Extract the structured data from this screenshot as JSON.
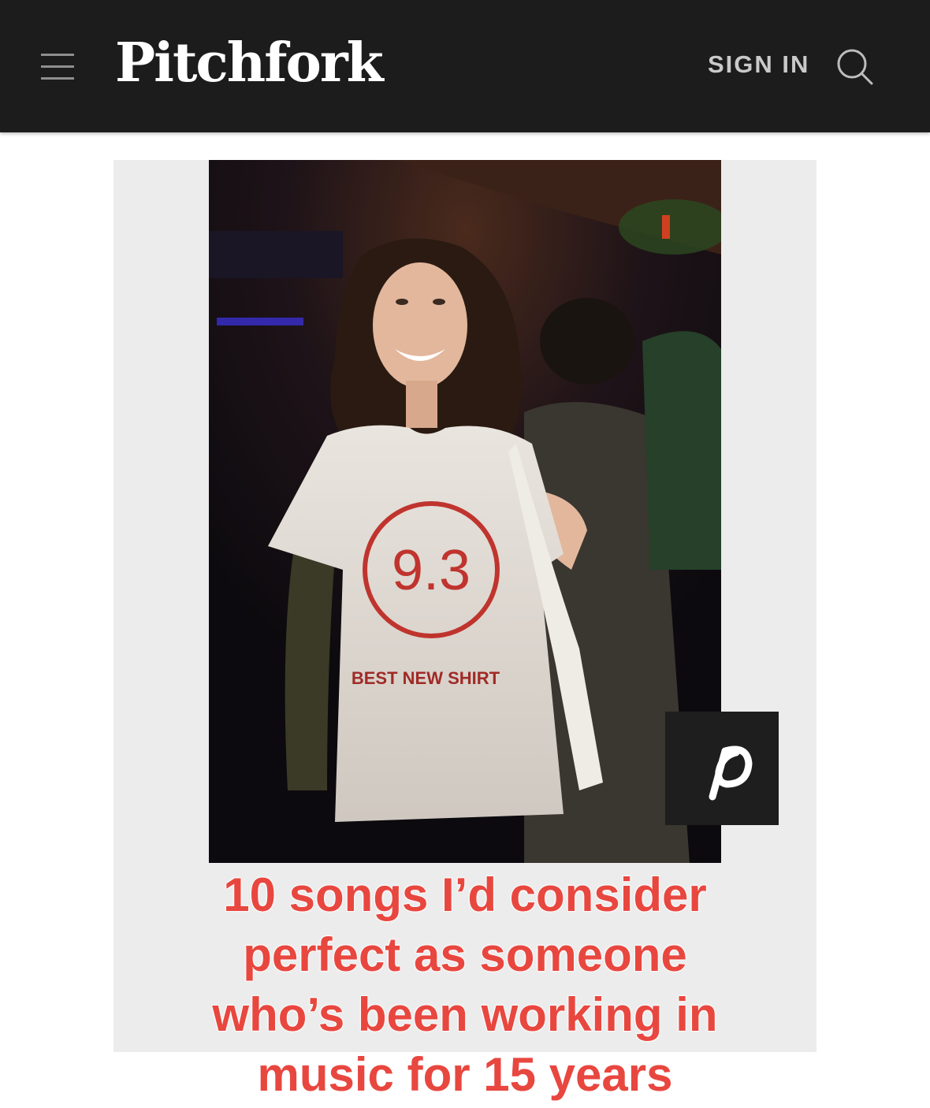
{
  "header": {
    "menu_icon": "hamburger-menu-icon",
    "logo_text": "Pitchfork",
    "signin_label": "SIGN IN",
    "search_icon": "search-icon",
    "background_color": "#1c1c1c"
  },
  "photo": {
    "shirt_score": "9.3",
    "shirt_text": "BEST NEW SHIRT",
    "pinterest_icon": "pinterest-icon"
  },
  "caption": {
    "lines": [
      "10 songs I’d consider",
      "perfect as someone",
      "who’s been working in",
      "music for 15 years"
    ],
    "color": "#e8473f"
  }
}
